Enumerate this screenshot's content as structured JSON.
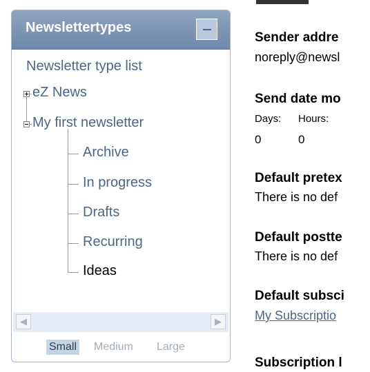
{
  "sidebar": {
    "title": "Newslettertypes",
    "tree": {
      "root_label": "Newsletter type list",
      "items": [
        {
          "label": "eZ News"
        },
        {
          "label": "My first newsletter"
        },
        {
          "label": "Archive"
        },
        {
          "label": "In progress"
        },
        {
          "label": "Drafts"
        },
        {
          "label": "Recurring"
        },
        {
          "label": "Ideas"
        }
      ]
    },
    "font_sizes": {
      "small": "Small",
      "medium": "Medium",
      "large": "Large",
      "selected": "Small"
    }
  },
  "details": {
    "sender_address": {
      "label": "Sender addre",
      "value": "noreply@newsl"
    },
    "send_date": {
      "label": "Send date mo",
      "columns": [
        {
          "label": "Days:",
          "value": "0"
        },
        {
          "label": "Hours:",
          "value": "0"
        }
      ]
    },
    "default_pretext": {
      "label": "Default pretex",
      "value": "There is no def"
    },
    "default_posttext": {
      "label": "Default postte",
      "value": "There is no def"
    },
    "default_subscription": {
      "label": "Default subsci",
      "value": "My Subscriptio"
    },
    "subscription": {
      "label": "Subscription l"
    }
  }
}
